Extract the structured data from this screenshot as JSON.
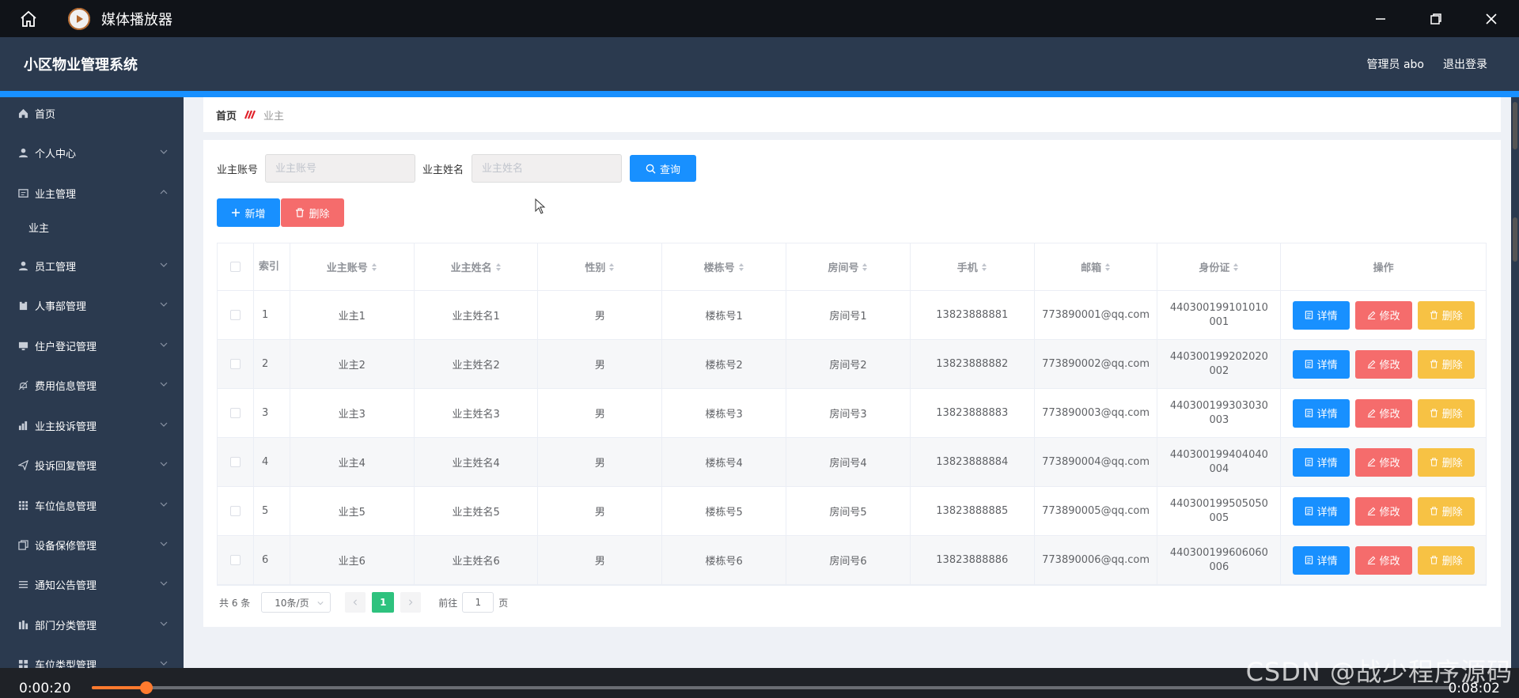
{
  "player": {
    "title": "媒体播放器",
    "current_time": "0:00:20",
    "total_time": "0:08:02",
    "progress_fraction": 0.04,
    "accent_color": "#ff7a2e"
  },
  "header": {
    "system_title": "小区物业管理系统",
    "admin_label": "管理员 abo",
    "logout_label": "退出登录"
  },
  "sidebar": {
    "items": [
      {
        "label": "首页",
        "icon": "home-icon"
      },
      {
        "label": "个人中心",
        "icon": "user-icon"
      },
      {
        "label": "业主管理",
        "icon": "id-card-icon"
      },
      {
        "label": "业主",
        "icon": ""
      },
      {
        "label": "员工管理",
        "icon": "user-icon"
      },
      {
        "label": "人事部管理",
        "icon": "clipboard-icon"
      },
      {
        "label": "住户登记管理",
        "icon": "monitor-icon"
      },
      {
        "label": "费用信息管理",
        "icon": "bell-icon"
      },
      {
        "label": "业主投诉管理",
        "icon": "chart-icon"
      },
      {
        "label": "投诉回复管理",
        "icon": "send-icon"
      },
      {
        "label": "车位信息管理",
        "icon": "grid-icon"
      },
      {
        "label": "设备保修管理",
        "icon": "copy-icon"
      },
      {
        "label": "通知公告管理",
        "icon": "list-icon"
      },
      {
        "label": "部门分类管理",
        "icon": "bars-icon"
      },
      {
        "label": "车位类型管理",
        "icon": "grid-icon"
      }
    ]
  },
  "breadcrumb": {
    "home": "首页",
    "current": "业主"
  },
  "search": {
    "account_label": "业主账号",
    "account_placeholder": "业主账号",
    "name_label": "业主姓名",
    "name_placeholder": "业主姓名",
    "query_label": "查询"
  },
  "actions": {
    "add_label": "新增",
    "delete_label": "删除"
  },
  "table": {
    "headers": {
      "index": "索引",
      "account": "业主账号",
      "name": "业主姓名",
      "sex": "性别",
      "building": "楼栋号",
      "room": "房间号",
      "phone": "手机",
      "email": "邮箱",
      "idcard": "身份证",
      "ops": "操作"
    },
    "row_buttons": {
      "detail": "详情",
      "edit": "修改",
      "delete": "删除"
    },
    "rows": [
      {
        "index": "1",
        "account": "业主1",
        "name": "业主姓名1",
        "sex": "男",
        "building": "楼栋号1",
        "room": "房间号1",
        "phone": "13823888881",
        "email": "773890001@qq.com",
        "idcard": "440300199101010001"
      },
      {
        "index": "2",
        "account": "业主2",
        "name": "业主姓名2",
        "sex": "男",
        "building": "楼栋号2",
        "room": "房间号2",
        "phone": "13823888882",
        "email": "773890002@qq.com",
        "idcard": "440300199202020002"
      },
      {
        "index": "3",
        "account": "业主3",
        "name": "业主姓名3",
        "sex": "男",
        "building": "楼栋号3",
        "room": "房间号3",
        "phone": "13823888883",
        "email": "773890003@qq.com",
        "idcard": "440300199303030003"
      },
      {
        "index": "4",
        "account": "业主4",
        "name": "业主姓名4",
        "sex": "男",
        "building": "楼栋号4",
        "room": "房间号4",
        "phone": "13823888884",
        "email": "773890004@qq.com",
        "idcard": "440300199404040004"
      },
      {
        "index": "5",
        "account": "业主5",
        "name": "业主姓名5",
        "sex": "男",
        "building": "楼栋号5",
        "room": "房间号5",
        "phone": "13823888885",
        "email": "773890005@qq.com",
        "idcard": "440300199505050005"
      },
      {
        "index": "6",
        "account": "业主6",
        "name": "业主姓名6",
        "sex": "男",
        "building": "楼栋号6",
        "room": "房间号6",
        "phone": "13823888886",
        "email": "773890006@qq.com",
        "idcard": "440300199606060006"
      }
    ]
  },
  "pagination": {
    "total": "共 6 条",
    "page_size": "10条/页",
    "current_page": "1",
    "goto_label": "前往",
    "goto_value": "1",
    "page_suffix": "页"
  },
  "watermark": "CSDN @战少程序源码",
  "colors": {
    "primary": "#1890ff",
    "danger": "#f56c6c",
    "warning": "#f7c244",
    "sidebar": "#2b3a4f",
    "pager_active": "#2ec27e"
  }
}
